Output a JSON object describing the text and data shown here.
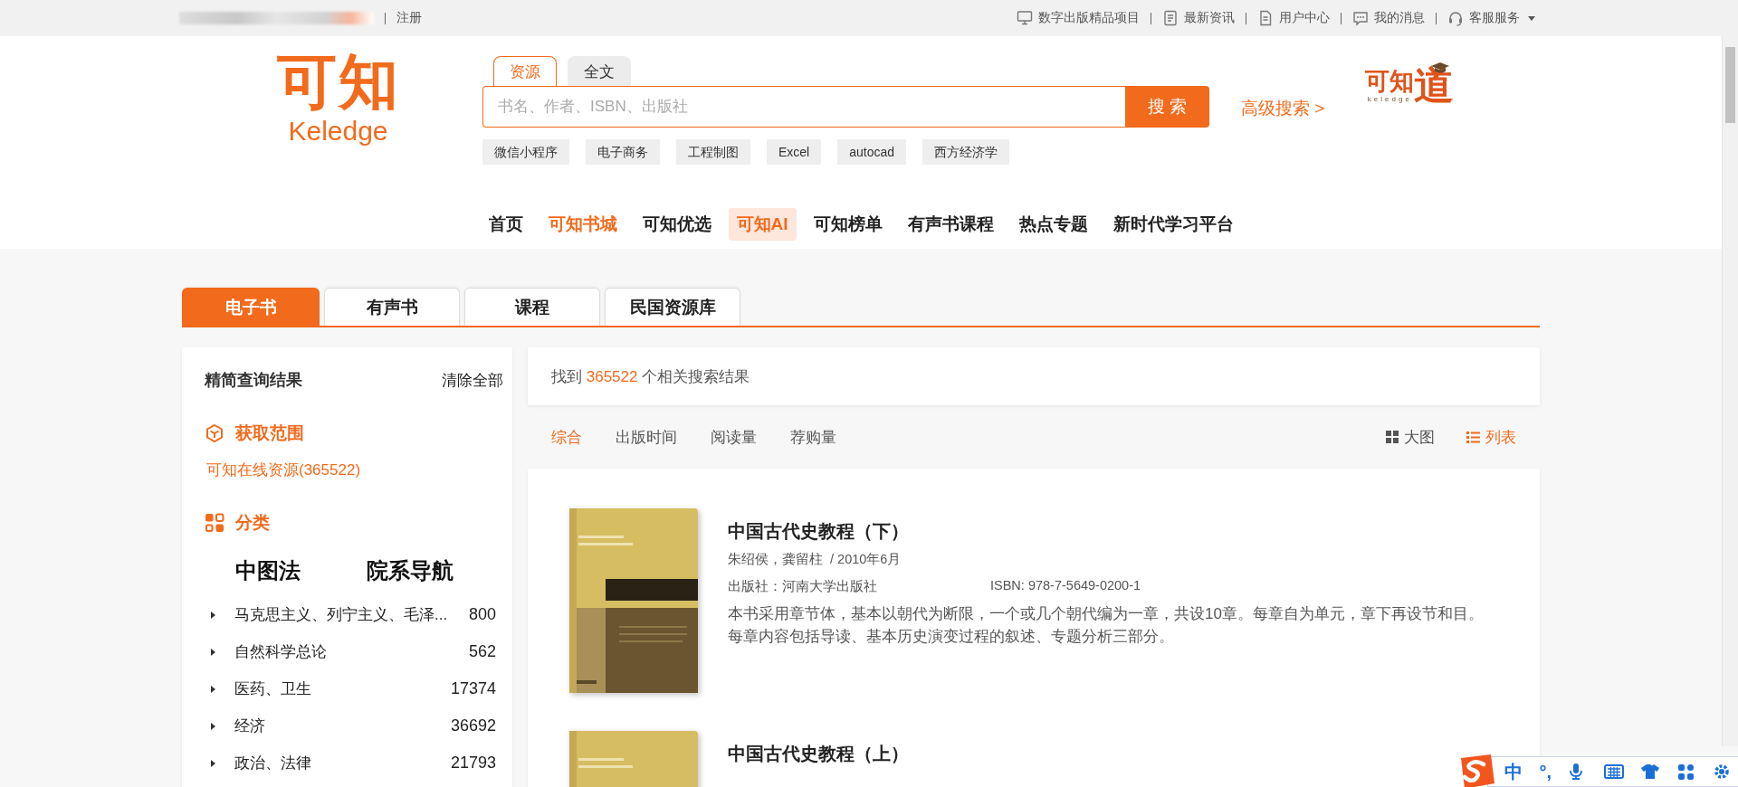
{
  "top_bar": {
    "register_link": "注册",
    "links": [
      {
        "label": "数字出版精品项目",
        "kind": "monitor"
      },
      {
        "label": "最新资讯",
        "kind": "news"
      },
      {
        "label": "用户中心",
        "kind": "document"
      },
      {
        "label": "我的消息",
        "kind": "message"
      },
      {
        "label": "客服服务",
        "kind": "headset",
        "dropdown": true
      }
    ]
  },
  "header": {
    "logo": {
      "text": "可知",
      "subtext": "Keledge"
    },
    "search": {
      "tabs": [
        {
          "label": "资源",
          "selected": true
        },
        {
          "label": "全文",
          "selected": false
        }
      ],
      "placeholder": "书名、作者、ISBN、出版社",
      "button": "搜 索"
    },
    "advanced_link": "高级搜索 >",
    "hot_tags": [
      "微信小程序",
      "电子商务",
      "工程制图",
      "Excel",
      "autocad",
      "西方经济学"
    ],
    "brand_logo": {
      "text": "可知",
      "glyph": "道",
      "subtext": "keledge"
    }
  },
  "nav": [
    {
      "label": "首页",
      "selected": false,
      "highlighted": false
    },
    {
      "label": "可知书城",
      "selected": true,
      "highlighted": false
    },
    {
      "label": "可知优选",
      "selected": false,
      "highlighted": false
    },
    {
      "label": "可知AI",
      "selected": false,
      "highlighted": true
    },
    {
      "label": "可知榜单",
      "selected": false,
      "highlighted": false
    },
    {
      "label": "有声书课程",
      "selected": false,
      "highlighted": false
    },
    {
      "label": "热点专题",
      "selected": false,
      "highlighted": false
    },
    {
      "label": "新时代学习平台",
      "selected": false,
      "highlighted": false
    }
  ],
  "resource_tabs": [
    {
      "label": "电子书",
      "selected": true
    },
    {
      "label": "有声书",
      "selected": false
    },
    {
      "label": "课程",
      "selected": false
    },
    {
      "label": "民国资源库",
      "selected": false
    }
  ],
  "sidebar": {
    "title": "精简查询结果",
    "clear": "清除全部",
    "sections": [
      {
        "kind": "scope",
        "title": "获取范围",
        "items": [
          "可知在线资源(365522)"
        ]
      },
      {
        "kind": "category",
        "title": "分类",
        "modes": [
          {
            "label": "中图法"
          },
          {
            "label": "院系导航"
          }
        ],
        "items": [
          {
            "name": "马克思主义、列宁主义、毛泽...",
            "count": "800",
            "expanded": false
          },
          {
            "name": "自然科学总论",
            "count": "562",
            "expanded": false
          },
          {
            "name": "医药、卫生",
            "count": "17374",
            "expanded": false
          },
          {
            "name": "经济",
            "count": "36692",
            "expanded": false
          },
          {
            "name": "政治、法律",
            "count": "21793",
            "expanded": false
          }
        ]
      }
    ]
  },
  "results": {
    "summary": {
      "prefix": "找到",
      "count": "365522",
      "suffix": "个相关搜索结果"
    },
    "sort": [
      {
        "label": "综合",
        "selected": true
      },
      {
        "label": "出版时间",
        "selected": false
      },
      {
        "label": "阅读量",
        "selected": false
      },
      {
        "label": "荐购量",
        "selected": false
      }
    ],
    "views": [
      {
        "label": "大图",
        "kind": "grid",
        "selected": false
      },
      {
        "label": "列表",
        "kind": "list",
        "selected": true
      }
    ],
    "books": [
      {
        "title": "中国古代史教程（下）",
        "byline": "朱绍侯，龚留柱  / 2010年6月",
        "publisher": "出版社：河南大学出版社",
        "isbn": "ISBN: 978-7-5649-0200-1",
        "description": "本书采用章节体，基本以朝代为断限，一个或几个朝代编为一章，共设10章。每章自为单元，章下再设节和目。每章内容包括导读、基本历史演变过程的叙述、专题分析三部分。"
      },
      {
        "title": "中国古代史教程（上）"
      }
    ]
  },
  "ime_toolbar": [
    {
      "kind": "text",
      "label": "中"
    },
    {
      "kind": "text",
      "label": "°,"
    },
    {
      "kind": "mic"
    },
    {
      "kind": "keyboard"
    },
    {
      "kind": "shirt"
    },
    {
      "kind": "apps"
    },
    {
      "kind": "gear"
    }
  ]
}
